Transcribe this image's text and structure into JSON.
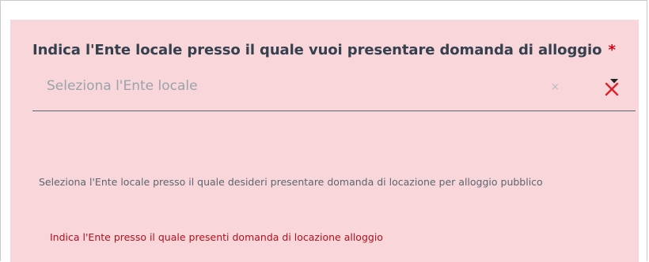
{
  "field": {
    "label": "Indica l'Ente locale presso il quale vuoi presentare domanda di alloggio",
    "required_mark": "*",
    "placeholder": "Seleziona l'Ente locale",
    "clear_glyph": "×",
    "helper": "Seleziona l'Ente locale presso il quale desideri presentare domanda di locazione per alloggio pubblico",
    "error": "Indica l'Ente presso il quale presenti domanda di locazione alloggio"
  },
  "icons": {
    "clear": "close-icon",
    "invalid": "invalid-x-icon"
  },
  "colors": {
    "panel_background": "#f8d6d9",
    "required": "#d0021b",
    "error_text": "#b0121f",
    "invalid_icon": "#e0202a",
    "label_text": "#35414f"
  }
}
